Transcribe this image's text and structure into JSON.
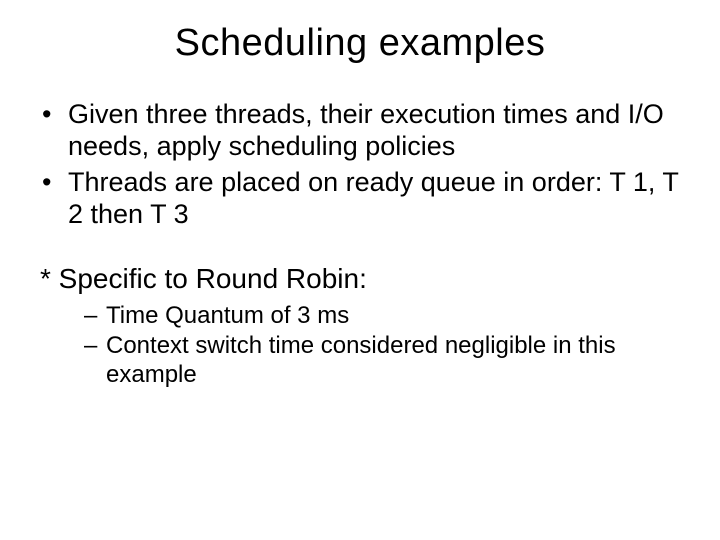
{
  "title": "Scheduling examples",
  "bullets": [
    "Given three threads, their execution times and I/O needs, apply scheduling policies",
    "Threads are placed on ready queue in order: T 1, T 2 then T 3"
  ],
  "note_heading": "* Specific to Round Robin:",
  "sub_bullets": [
    "Time Quantum of 3 ms",
    "Context switch time considered negligible in this example"
  ]
}
